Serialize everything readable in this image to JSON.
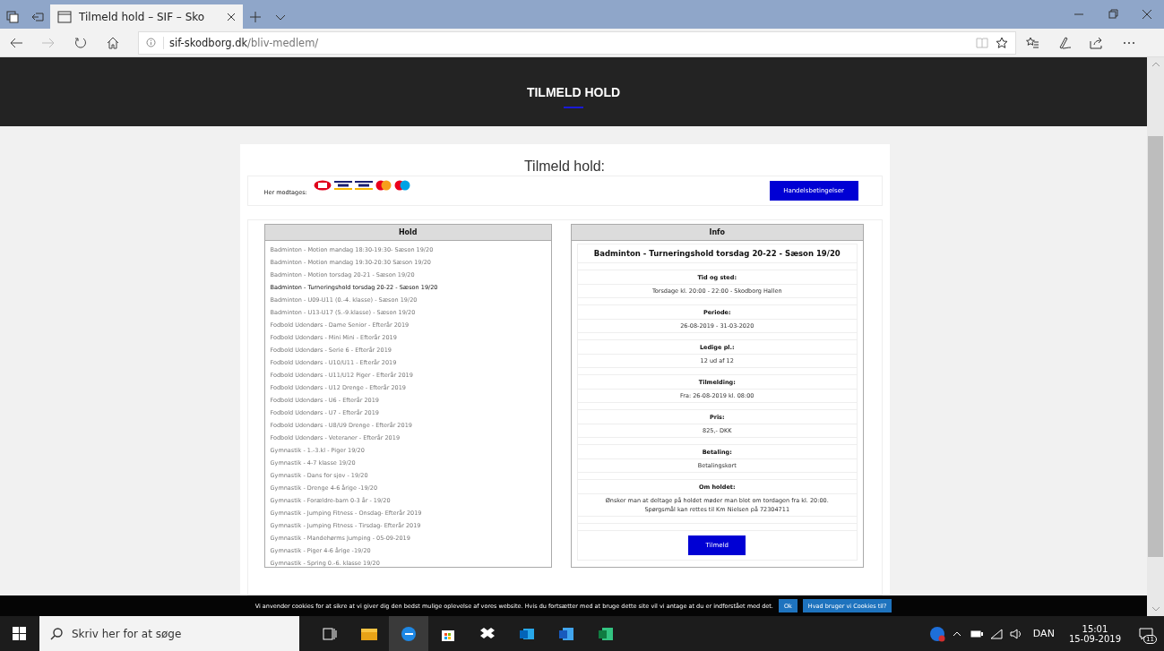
{
  "browser": {
    "tab_title": "Tilmeld hold – SIF – Sko",
    "address_domain": "sif-skodborg.dk",
    "address_path": "/bliv-medlem/"
  },
  "header_title": "TILMELD HOLD",
  "form": {
    "title": "Tilmeld hold:",
    "payments_label": "Her modtages:",
    "terms_button": "Handelsbetingelser"
  },
  "hold_panel": {
    "heading": "Hold",
    "items": [
      {
        "label": "Badminton - Motion mandag 18:30-19:30- Sæson 19/20",
        "selected": false
      },
      {
        "label": "Badminton - Motion mandag 19:30-20:30 Sæson 19/20",
        "selected": false
      },
      {
        "label": "Badminton - Motion torsdag 20-21 - Sæson 19/20",
        "selected": false
      },
      {
        "label": "Badminton - Turneringshold torsdag 20-22 - Sæson 19/20",
        "selected": true
      },
      {
        "label": "Badminton - U09-U11 (0.-4. klasse) - Sæson 19/20",
        "selected": false
      },
      {
        "label": "Badminton - U13-U17 (5.-9.klasse) - Sæson 19/20",
        "selected": false
      },
      {
        "label": "Fodbold Udendørs - Dame Senior - Efterår 2019",
        "selected": false
      },
      {
        "label": "Fodbold Udendørs - Mini Mini - Efterår 2019",
        "selected": false
      },
      {
        "label": "Fodbold Udendørs - Serie 6 - Efterår 2019",
        "selected": false
      },
      {
        "label": "Fodbold Udendørs - U10/U11 - Efterår 2019",
        "selected": false
      },
      {
        "label": "Fodbold Udendørs - U11/U12 Piger - Efterår 2019",
        "selected": false
      },
      {
        "label": "Fodbold Udendørs - U12 Drenge - Efterår 2019",
        "selected": false
      },
      {
        "label": "Fodbold Udendørs - U6 - Efterår 2019",
        "selected": false
      },
      {
        "label": "Fodbold Udendørs - U7 - Efterår 2019",
        "selected": false
      },
      {
        "label": "Fodbold Udendørs - U8/U9 Drenge - Efterår 2019",
        "selected": false
      },
      {
        "label": "Fodbold Udendørs - Veteraner - Efterår 2019",
        "selected": false
      },
      {
        "label": "Gymnastik - 1.-3.kl - Piger 19/20",
        "selected": false
      },
      {
        "label": "Gymnastik - 4-7 klasse 19/20",
        "selected": false
      },
      {
        "label": "Gymnastik - Dans for sjov - 19/20",
        "selected": false
      },
      {
        "label": "Gymnastik - Drenge 4-6 årige -19/20",
        "selected": false
      },
      {
        "label": "Gymnastik - Forældre-barn 0-3 år - 19/20",
        "selected": false
      },
      {
        "label": "Gymnastik - Jumping Fitness - Onsdag- Efterår 2019",
        "selected": false
      },
      {
        "label": "Gymnastik - Jumping Fitness - Tirsdag- Efterår 2019",
        "selected": false
      },
      {
        "label": "Gymnastik - Mandehørms Jumping - 05-09-2019",
        "selected": false
      },
      {
        "label": "Gymnastik - Piger 4-6 årige -19/20",
        "selected": false
      },
      {
        "label": "Gymnastik - Spring 0.-6. klasse 19/20",
        "selected": false
      }
    ]
  },
  "info_panel": {
    "heading": "Info",
    "team_title": "Badminton - Turneringshold torsdag 20-22 - Sæson 19/20",
    "sections": [
      {
        "label": "Tid og sted:",
        "lines": [
          "Torsdage kl. 20:00 - 22:00 - Skodborg Hallen"
        ]
      },
      {
        "label": "Periode:",
        "lines": [
          "26-08-2019 - 31-03-2020"
        ]
      },
      {
        "label": "Ledige pl.:",
        "lines": [
          "12 ud af 12"
        ]
      },
      {
        "label": "Tilmelding:",
        "lines": [
          "Fra: 26-08-2019 kl. 08:00"
        ]
      },
      {
        "label": "Pris:",
        "lines": [
          "825,- DKK"
        ]
      },
      {
        "label": "Betaling:",
        "lines": [
          "Betalingskort"
        ]
      },
      {
        "label": "Om holdet:",
        "lines": [
          "Ønsker man at deltage på holdet møder man blot om tordagen fra kl. 20:00.",
          "Spørgsmål kan rettes til Km Nielsen på 72304711"
        ]
      }
    ],
    "signup_button": "Tilmeld"
  },
  "cookie_bar": {
    "text": "Vi anvender cookies for at sikre at vi giver dig den bedst mulige oplevelse af vores website. Hvis du fortsætter med at bruge dette site vil vi antage at du er indforstået med det.",
    "ok_button": "Ok",
    "info_button": "Hvad bruger vi Cookies til?"
  },
  "taskbar": {
    "search_placeholder": "Skriv her for at søge",
    "language": "DAN",
    "time": "15:01",
    "date": "15-09-2019",
    "notification_count": "11"
  }
}
